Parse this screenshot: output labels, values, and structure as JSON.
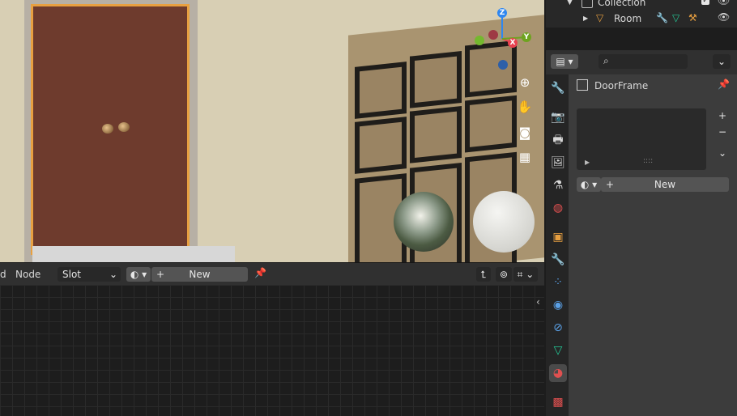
{
  "outliner": {
    "collection_label": "Collection",
    "room_label": "Room"
  },
  "properties": {
    "object_name": "DoorFrame",
    "new_button": "New",
    "slot_list_handle": "::::"
  },
  "node_editor": {
    "node_menu": "Node",
    "slot_select": "Slot",
    "new_button": "New",
    "cut_menu_fragment": "d"
  },
  "gizmo": {
    "z_label": "Z",
    "x_label": "X",
    "y_label": "Y"
  },
  "colors": {
    "accent_orange": "#e8a040",
    "gizmo_x": "#e8414f",
    "gizmo_y": "#6ea320",
    "gizmo_z": "#2f87f0"
  },
  "icons": [
    "tool-icon",
    "render-icon",
    "output-icon",
    "view-layer-icon",
    "scene-icon",
    "world-icon",
    "object-icon",
    "modifier-icon",
    "particles-icon",
    "physics-icon",
    "constraints-icon",
    "data-icon",
    "material-icon",
    "texture-icon"
  ]
}
